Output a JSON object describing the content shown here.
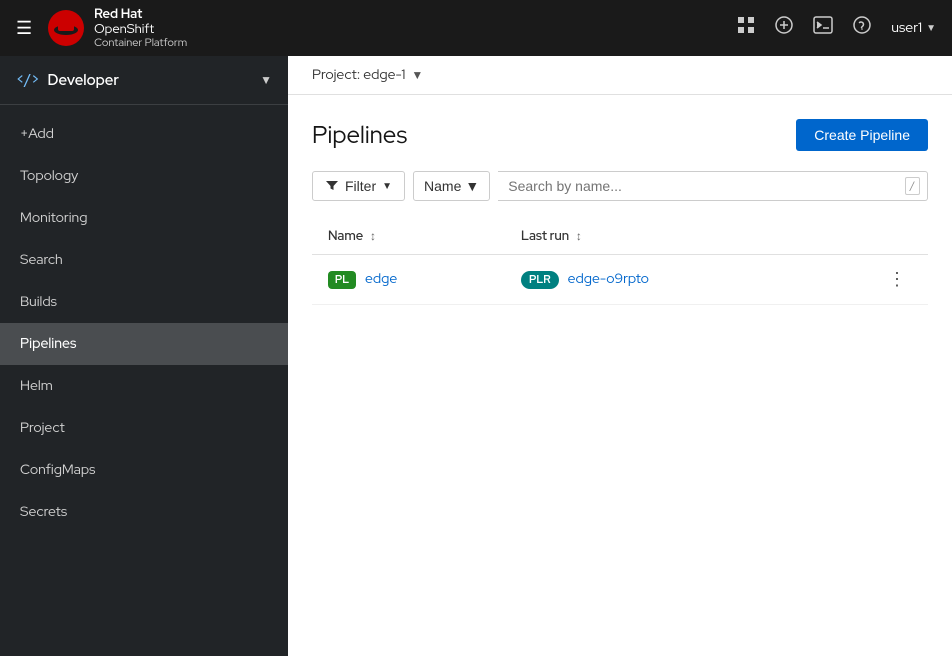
{
  "topnav": {
    "brand": {
      "line1": "Red Hat",
      "line2": "OpenShift",
      "line3": "Container Platform"
    },
    "icons": {
      "grid": "⊞",
      "plus": "+",
      "terminal": ">_",
      "help": "?"
    },
    "user": "user1"
  },
  "sidebar": {
    "perspective": {
      "icon": "</>",
      "label": "Developer"
    },
    "items": [
      {
        "id": "add",
        "label": "+Add",
        "active": false
      },
      {
        "id": "topology",
        "label": "Topology",
        "active": false
      },
      {
        "id": "monitoring",
        "label": "Monitoring",
        "active": false
      },
      {
        "id": "search",
        "label": "Search",
        "active": false
      },
      {
        "id": "builds",
        "label": "Builds",
        "active": false
      },
      {
        "id": "pipelines",
        "label": "Pipelines",
        "active": true
      },
      {
        "id": "helm",
        "label": "Helm",
        "active": false
      },
      {
        "id": "project",
        "label": "Project",
        "active": false
      },
      {
        "id": "configmaps",
        "label": "ConfigMaps",
        "active": false
      },
      {
        "id": "secrets",
        "label": "Secrets",
        "active": false
      }
    ]
  },
  "content": {
    "project": {
      "label": "Project: edge-1"
    },
    "page": {
      "title": "Pipelines",
      "create_button": "Create Pipeline"
    },
    "filter": {
      "filter_label": "Filter",
      "name_label": "Name",
      "search_placeholder": "Search by name..."
    },
    "table": {
      "columns": [
        {
          "id": "name",
          "label": "Name"
        },
        {
          "id": "last_run",
          "label": "Last run"
        }
      ],
      "rows": [
        {
          "badge": "PL",
          "badge_type": "pl",
          "name": "edge",
          "run_badge": "PLR",
          "run_badge_type": "plr",
          "last_run": "edge-o9rpto"
        }
      ]
    }
  }
}
